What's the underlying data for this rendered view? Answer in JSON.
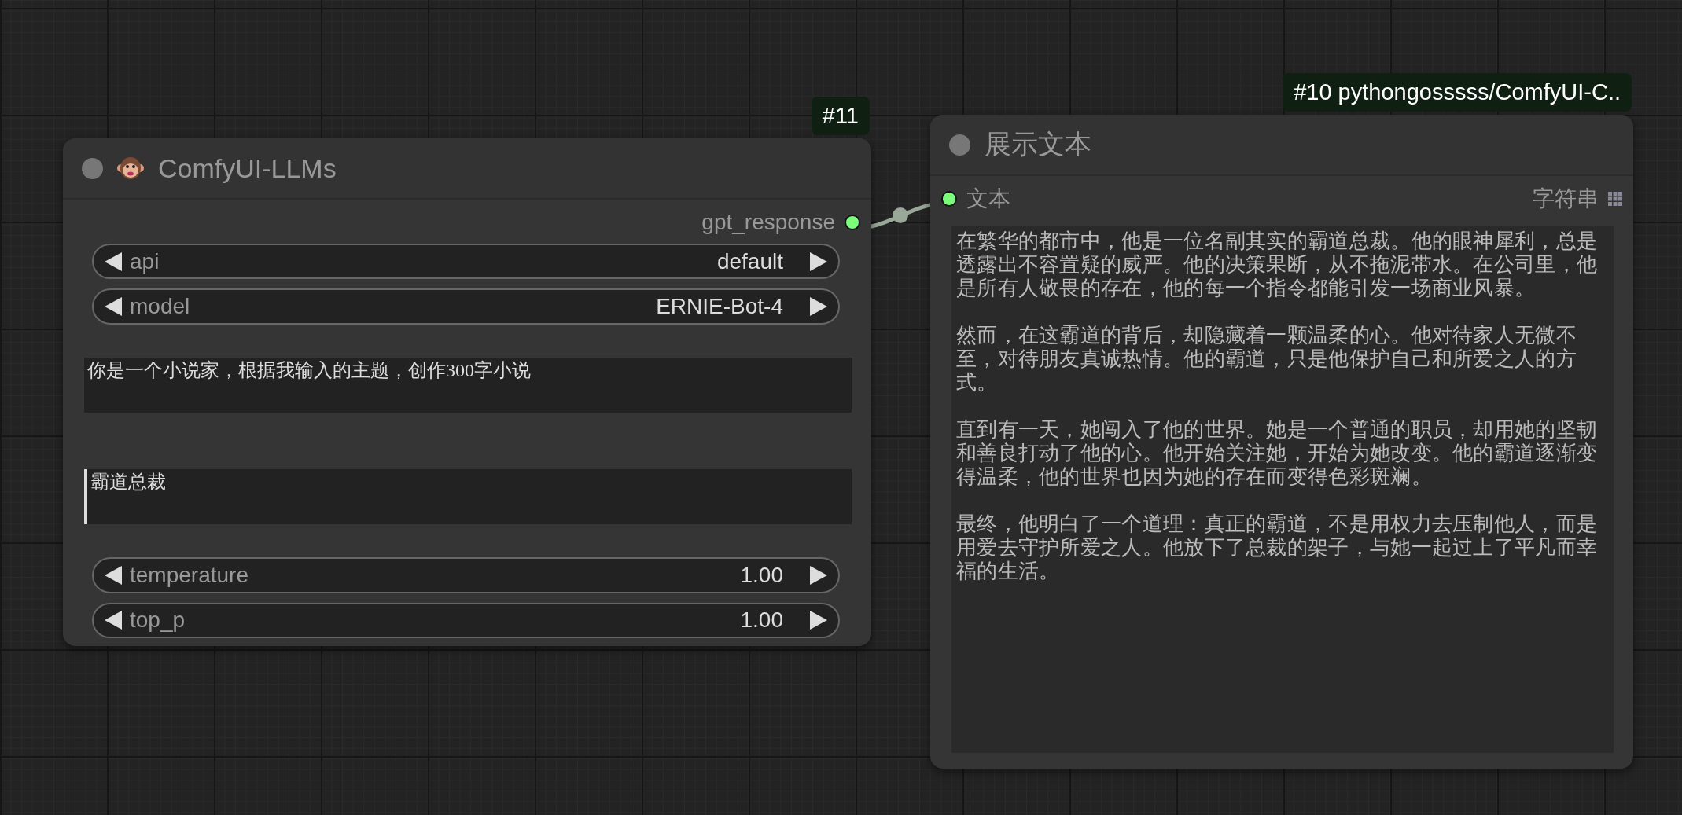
{
  "nodes": [
    {
      "badge": "#11",
      "title": "ComfyUI-LLMs",
      "emoji_icon": true,
      "outputs": [
        {
          "name": "gpt_response"
        }
      ],
      "widgets": [
        {
          "kind": "combo",
          "label": "api",
          "value": "default"
        },
        {
          "kind": "combo",
          "label": "model",
          "value": "ERNIE-Bot-4"
        },
        {
          "kind": "text",
          "value": "你是一个小说家，根据我输入的主题，创作300字小说",
          "focused": false
        },
        {
          "kind": "text",
          "value": "霸道总裁",
          "focused": true
        },
        {
          "kind": "number",
          "label": "temperature",
          "value": "1.00"
        },
        {
          "kind": "number",
          "label": "top_p",
          "value": "1.00"
        }
      ]
    },
    {
      "badge": "#10 pythongosssss/ComfyUI-C..",
      "title": "展示文本",
      "inputs": [
        {
          "name": "文本",
          "type": "字符串"
        }
      ],
      "widgets": [
        {
          "kind": "display",
          "paragraphs": [
            "在繁华的都市中，他是一位名副其实的霸道总裁。他的眼神犀利，总是透露出不容置疑的威严。他的决策果断，从不拖泥带水。在公司里，他是所有人敬畏的存在，他的每一个指令都能引发一场商业风暴。",
            "然而，在这霸道的背后，却隐藏着一颗温柔的心。他对待家人无微不至，对待朋友真诚热情。他的霸道，只是他保护自己和所爱之人的方式。",
            "直到有一天，她闯入了他的世界。她是一个普通的职员，却用她的坚韧和善良打动了他的心。他开始关注她，开始为她改变。他的霸道逐渐变得温柔，他的世界也因为她的存在而变得色彩斑斓。",
            "最终，他明白了一个道理：真正的霸道，不是用权力去压制他人，而是用爱去守护所爱之人。他放下了总裁的架子，与她一起过上了平凡而幸福的生活。"
          ]
        }
      ]
    }
  ]
}
